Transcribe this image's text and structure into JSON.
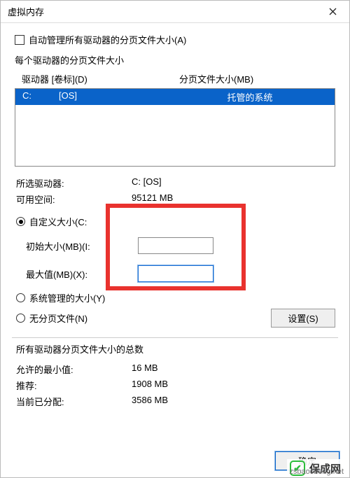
{
  "window": {
    "title": "虚拟内存"
  },
  "auto_manage": {
    "label": "自动管理所有驱动器的分页文件大小(A)",
    "checked": false
  },
  "per_drive_heading": "每个驱动器的分页文件大小",
  "table_head": {
    "drive": "驱动器 [卷标](D)",
    "paging": "分页文件大小(MB)"
  },
  "list": {
    "selected": {
      "drive_letter": "C:",
      "volume_label": "[OS]",
      "paging": "托管的系统"
    }
  },
  "selected_info": {
    "drive_label": "所选驱动器:",
    "drive_value": "C:  [OS]",
    "space_label": "可用空间:",
    "space_value": "95121 MB"
  },
  "size_mode": {
    "custom": {
      "label": "自定义大小(C:",
      "checked": true
    },
    "initial_label": "初始大小(MB)(I:",
    "initial_value": "",
    "max_label": "最大值(MB)(X):",
    "max_value": "",
    "system": {
      "label": "系统管理的大小(Y)",
      "checked": false
    },
    "none": {
      "label": "无分页文件(N)",
      "checked": false
    }
  },
  "set_button": "设置(S)",
  "totals": {
    "heading": "所有驱动器分页文件大小的总数",
    "min_label": "允许的最小值:",
    "min_value": "16 MB",
    "rec_label": "推荐:",
    "rec_value": "1908 MB",
    "cur_label": "当前已分配:",
    "cur_value": "3586 MB"
  },
  "buttons": {
    "ok": "确定"
  },
  "watermark": {
    "brand": "保成网",
    "url": "zsbaocheng.net"
  }
}
